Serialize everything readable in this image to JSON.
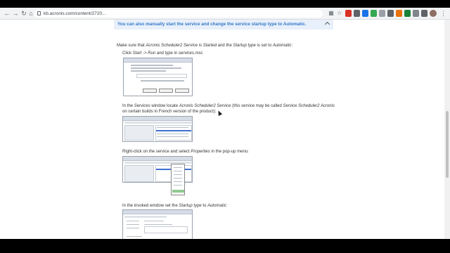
{
  "browser": {
    "url": "kb.acronis.com/content/2720...",
    "url_full": "kb.acronis.com/content/2720"
  },
  "banner": {
    "text": "You can also manually start the service and change the service startup type to Automatic."
  },
  "intro": {
    "t1": "Make sure that ",
    "t2": "Acronis Scheduler2 Service",
    "t3": " is ",
    "t4": "Started",
    "t5": " and the ",
    "t6": "Startup type",
    "t7": " is set to ",
    "t8": "Automatic",
    "t9": ":"
  },
  "steps": [
    {
      "a": "Click ",
      "b": "Start -> Run",
      "c": " and type in ",
      "d": "services.msc"
    },
    {
      "a": "In the ",
      "b": "Services",
      "c": " window locate ",
      "d": "Acronis Scheduler2 Service",
      "e": " (this service may be called ",
      "f": "Service Scheduler2 Acronis",
      "g": "on certain builds in French version of the product):"
    },
    {
      "a": "Right-click on the service and select ",
      "b": "Properties",
      "c": " in the pop-up menu:"
    },
    {
      "a": "In the invoked window set the ",
      "b": "Startup type",
      "c": " to ",
      "d": "Automatic",
      "e": ":"
    }
  ],
  "colors": {
    "banner_bg": "#e8f0fb",
    "banner_text": "#3478c6"
  }
}
